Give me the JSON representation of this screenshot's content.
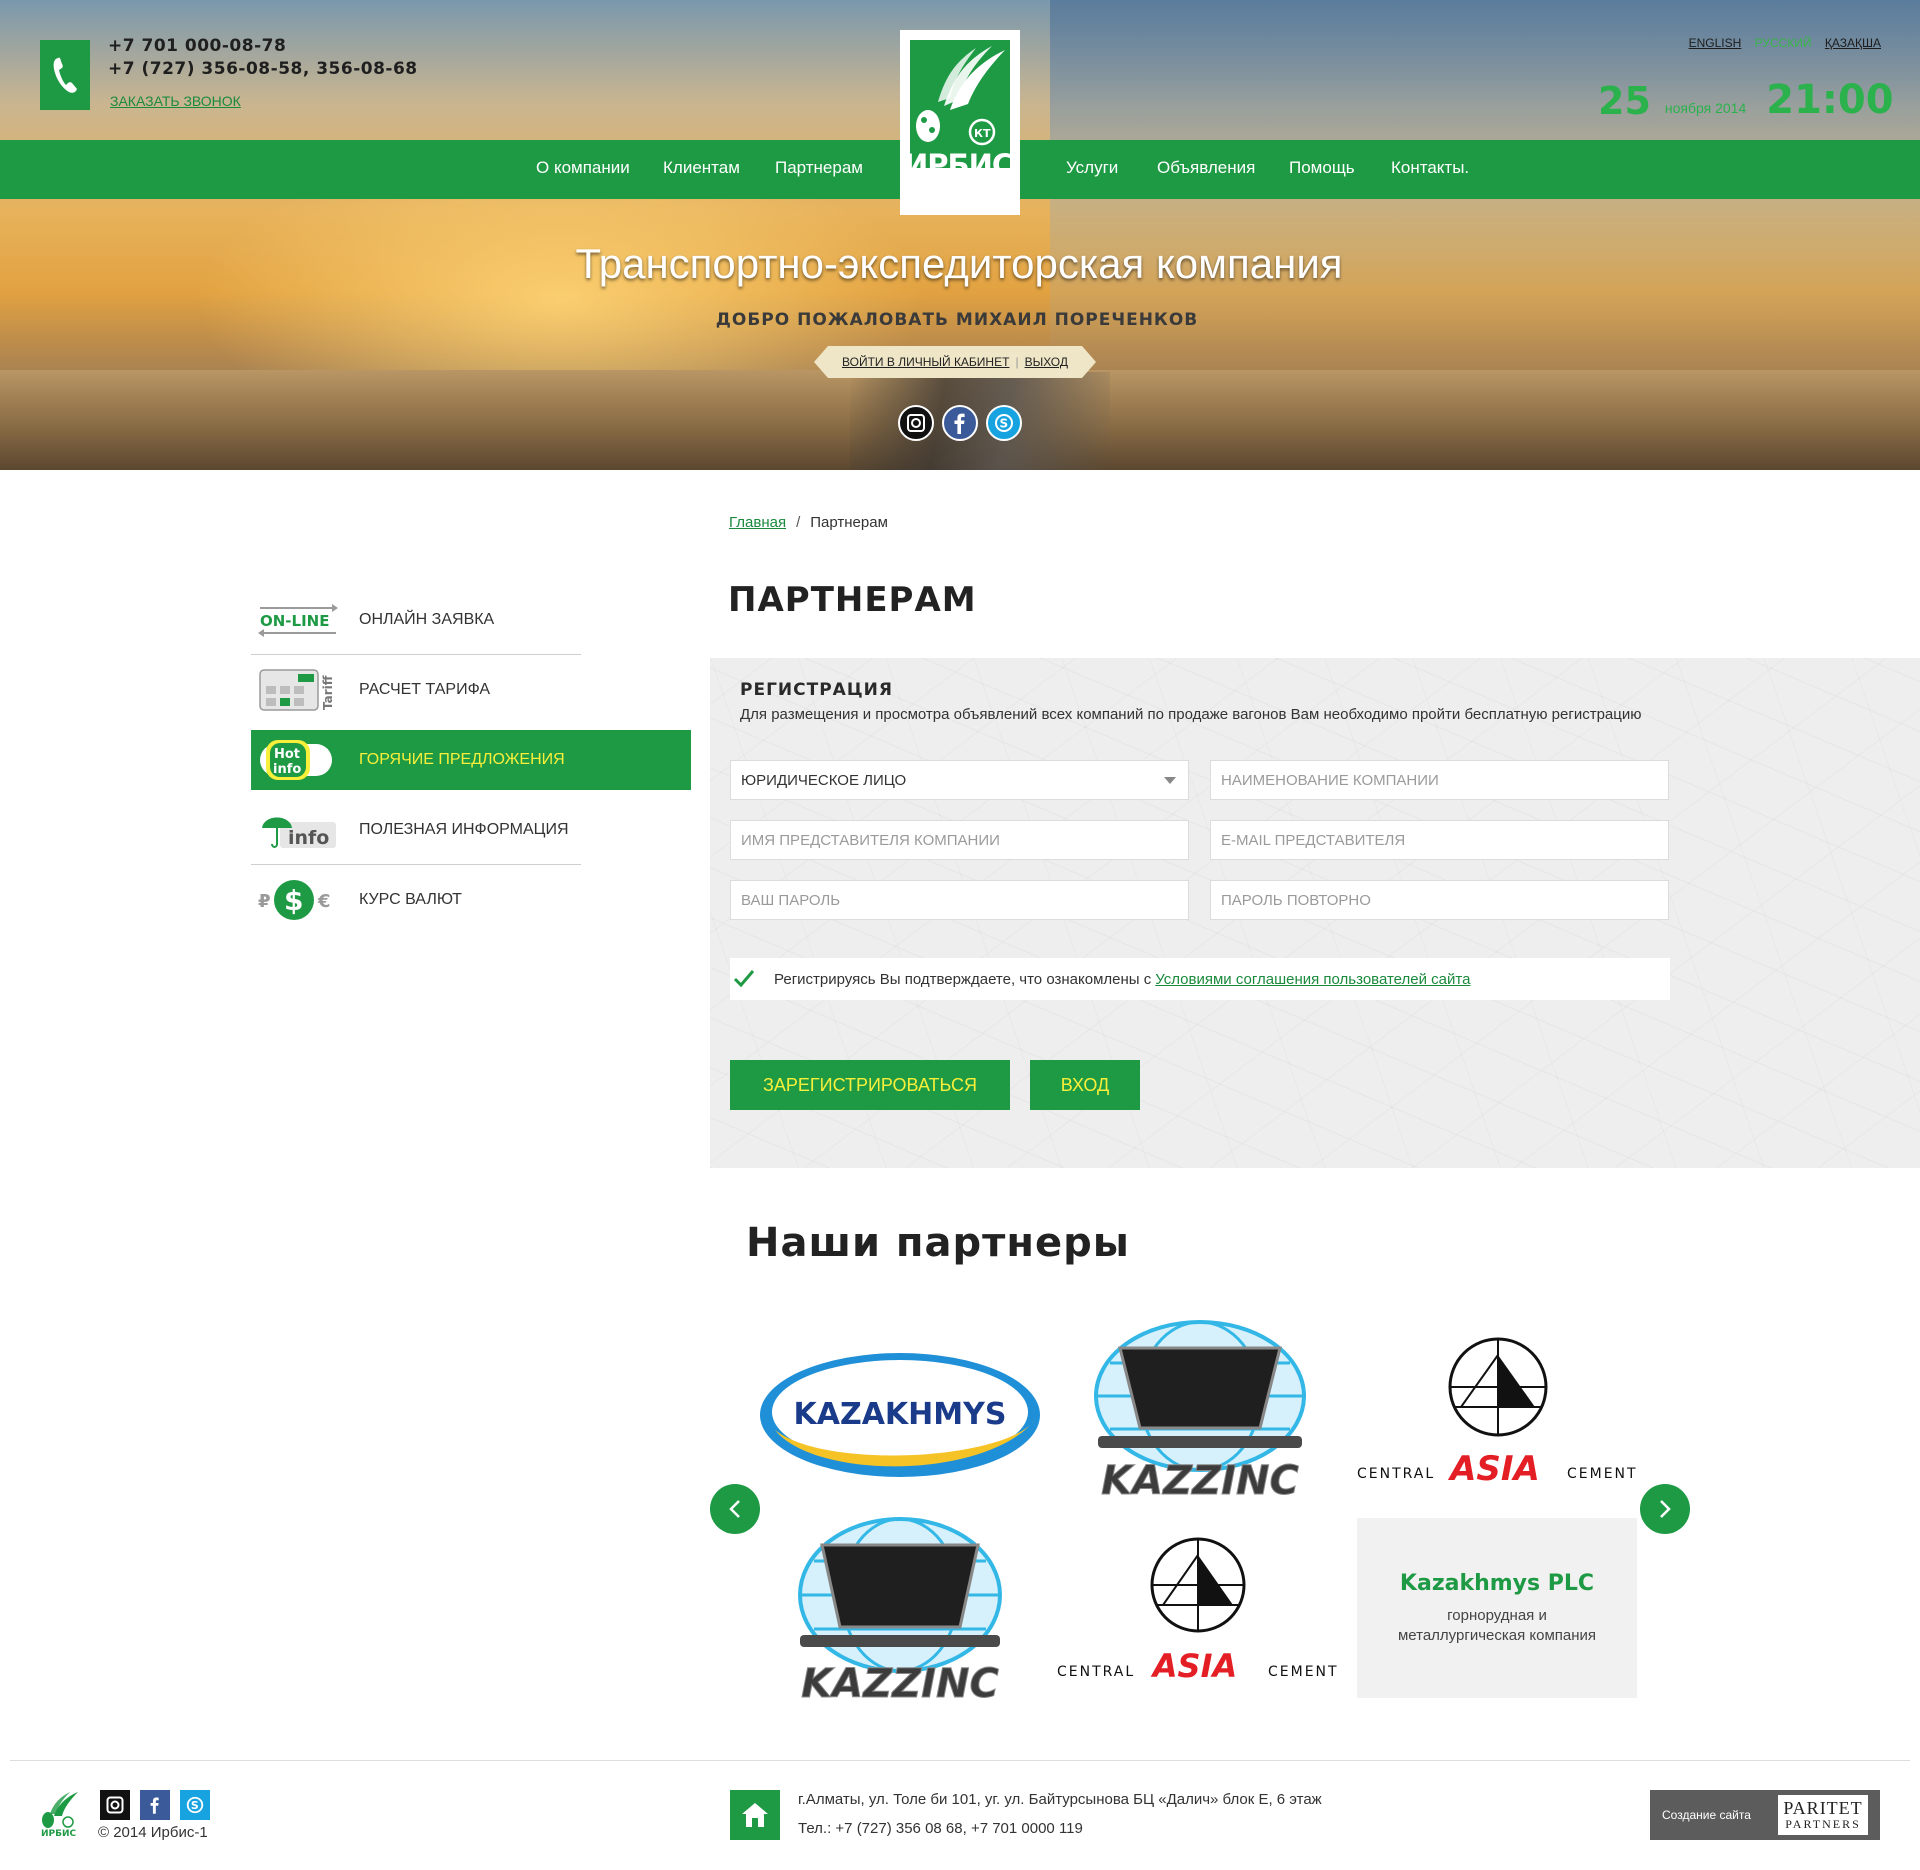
{
  "header": {
    "phones": [
      "+7 701 000-08-78",
      "+7 (727) 356-08-58, 356-08-68"
    ],
    "callback_link": "ЗАКАЗАТЬ ЗВОНОК",
    "languages": [
      {
        "label": "ENGLISH",
        "active": false
      },
      {
        "label": "РУССКИЙ",
        "active": true
      },
      {
        "label": "ҚАЗАҚША",
        "active": false
      }
    ],
    "date": {
      "day": "25",
      "month_year": "ноября 2014",
      "time": "21:00"
    },
    "logo_text": "ИРБИС 1",
    "nav": [
      "О компании",
      "Клиентам",
      "Партнерам",
      "Услуги",
      "Объявления",
      "Помощь",
      "Контакты."
    ]
  },
  "hero": {
    "title": "Транспортно-экспедиторская компания",
    "welcome": "ДОБРО ПОЖАЛОВАТЬ МИХАИЛ ПОРЕЧЕНКОВ",
    "cabinet_link": "ВОЙТИ В ЛИЧНЫЙ КАБИНЕТ",
    "logout_link": "ВЫХОД",
    "social": [
      "instagram-icon",
      "facebook-icon",
      "skype-icon"
    ]
  },
  "breadcrumb": {
    "home": "Главная",
    "separator": "/",
    "current": "Партнерам"
  },
  "page_title": "ПАРТНЕРАМ",
  "sidebar": {
    "items": [
      {
        "label": "ОНЛАЙН ЗАЯВКА",
        "icon": "online-icon",
        "icon_text": "ON-LINE",
        "active": false
      },
      {
        "label": "РАСЧЕТ ТАРИФА",
        "icon": "tariff-calculator-icon",
        "icon_text": "Tariff",
        "active": false
      },
      {
        "label": "ГОРЯЧИЕ ПРЕДЛОЖЕНИЯ",
        "icon": "hot-info-icon",
        "icon_text": "Hot info",
        "active": true
      },
      {
        "label": "ПОЛЕЗНАЯ ИНФОРМАЦИЯ",
        "icon": "umbrella-info-icon",
        "icon_text": "info",
        "active": false
      },
      {
        "label": "КУРС ВАЛЮТ",
        "icon": "currency-icon",
        "icon_text": "₽ $ €",
        "active": false
      }
    ]
  },
  "registration": {
    "title": "РЕГИСТРАЦИЯ",
    "description": "Для размещения и просмотра объявлений всех компаний по продаже вагонов Вам необходимо пройти бесплатную регистрацию",
    "entity_type_value": "ЮРИДИЧЕСКОЕ ЛИЦО",
    "placeholders": {
      "company_name": "НАИМЕНОВАНИЕ КОМПАНИИ",
      "representative_name": "ИМЯ ПРЕДСТАВИТЕЛЯ КОМПАНИИ",
      "representative_email": "E-MAIL ПРЕДСТАВИТЕЛЯ",
      "password": "ВАШ ПАРОЛЬ",
      "password_repeat": "ПАРОЛЬ ПОВТОРНО"
    },
    "agree_text": "Регистрируясь Вы подтверждаете, что ознакомлены с",
    "agree_link": "Условиями соглашения пользователей сайта",
    "agree_checked": true,
    "register_button": "ЗАРЕГИСТРИРОВАТЬСЯ",
    "login_button": "ВХОД"
  },
  "partners": {
    "title": "Наши партнеры",
    "logos": [
      {
        "name": "KAZAKHMYS"
      },
      {
        "name": "KAZZINC"
      },
      {
        "name_left": "CENTRAL",
        "name_mid": "ASIA",
        "name_right": "CEMENT"
      },
      {
        "name": "KAZZINC"
      },
      {
        "name_left": "CENTRAL",
        "name_mid": "ASIA",
        "name_right": "CEMENT"
      }
    ],
    "featured": {
      "name": "Kazakhmys PLC",
      "description": "горнорудная и металлургическая компания"
    }
  },
  "footer": {
    "logo_text": "ИРБИС 1",
    "copyright": "© 2014  Ирбис-1",
    "address": "г.Алматы, ул. Толе би 101, уг. ул. Байтурсынова БЦ «Далич» блок Е, 6 этаж",
    "phones": "Тел.: +7 (727) 356 08 68, +7 701 0000 119",
    "made_by": "Создание сайта",
    "brand_top": "PARITET",
    "brand_bottom": "PARTNERS"
  },
  "colors": {
    "brand_green": "#1e9a45",
    "accent_yellow": "#f7ef3a",
    "link_green": "#1b8a3d"
  }
}
